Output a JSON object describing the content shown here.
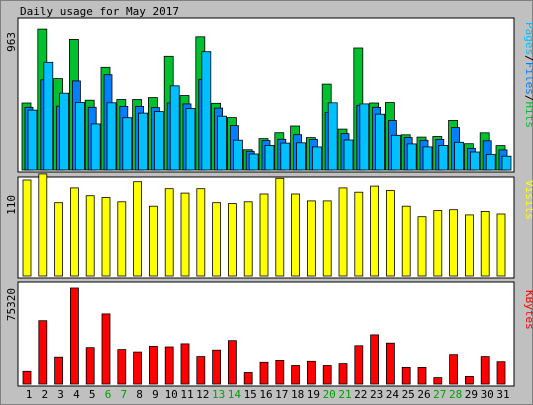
{
  "chart_data": [
    {
      "type": "bar",
      "title": "Daily usage for May 2017",
      "ylabel_parts": [
        "Pages",
        "/",
        "Files",
        "/",
        "Hits"
      ],
      "ymax_label": "963",
      "ylim": [
        0,
        963
      ],
      "categories": [
        "1",
        "2",
        "3",
        "4",
        "5",
        "6",
        "7",
        "8",
        "9",
        "10",
        "11",
        "12",
        "13",
        "14",
        "15",
        "16",
        "17",
        "18",
        "19",
        "20",
        "21",
        "22",
        "23",
        "24",
        "25",
        "26",
        "27",
        "28",
        "29",
        "30",
        "31"
      ],
      "weekend_days": [
        "6",
        "7",
        "13",
        "14",
        "20",
        "21",
        "27",
        "28"
      ],
      "series": [
        {
          "name": "Hits",
          "color": "#00c030",
          "values": [
            436,
            917,
            595,
            850,
            454,
            668,
            459,
            459,
            471,
            740,
            485,
            867,
            434,
            341,
            132,
            204,
            243,
            286,
            211,
            559,
            266,
            794,
            436,
            439,
            229,
            214,
            218,
            323,
            171,
            242,
            159
          ]
        },
        {
          "name": "Files",
          "color": "#0080ff",
          "values": [
            408,
            587,
            416,
            580,
            408,
            620,
            414,
            414,
            406,
            436,
            430,
            590,
            403,
            289,
            122,
            191,
            200,
            230,
            199,
            375,
            237,
            421,
            408,
            322,
            211,
            193,
            199,
            276,
            141,
            190,
            131
          ]
        },
        {
          "name": "Pages",
          "color": "#00c0ff",
          "values": [
            390,
            701,
            500,
            440,
            300,
            437,
            340,
            370,
            380,
            548,
            400,
            770,
            350,
            194,
            104,
            160,
            175,
            177,
            150,
            437,
            195,
            430,
            363,
            226,
            170,
            150,
            160,
            180,
            117,
            100,
            90
          ]
        }
      ]
    },
    {
      "type": "bar",
      "ylabel": "Visits",
      "ymax_label": "110",
      "ylim": [
        0,
        110
      ],
      "categories": [
        "1",
        "2",
        "3",
        "4",
        "5",
        "6",
        "7",
        "8",
        "9",
        "10",
        "11",
        "12",
        "13",
        "14",
        "15",
        "16",
        "17",
        "18",
        "19",
        "20",
        "21",
        "22",
        "23",
        "24",
        "25",
        "26",
        "27",
        "28",
        "29",
        "30",
        "31"
      ],
      "series": [
        {
          "name": "Visits",
          "color": "#ffff00",
          "values": [
            110,
            117,
            84,
            101,
            92,
            90,
            85,
            108,
            80,
            100,
            95,
            100,
            84,
            83,
            85,
            94,
            112,
            94,
            86,
            86,
            101,
            96,
            103,
            98,
            80,
            68,
            75,
            76,
            70,
            74,
            71
          ]
        }
      ]
    },
    {
      "type": "bar",
      "ylabel": "KBytes",
      "ymax_label": "75320",
      "ylim": [
        0,
        75320
      ],
      "categories": [
        "1",
        "2",
        "3",
        "4",
        "5",
        "6",
        "7",
        "8",
        "9",
        "10",
        "11",
        "12",
        "13",
        "14",
        "15",
        "16",
        "17",
        "18",
        "19",
        "20",
        "21",
        "22",
        "23",
        "24",
        "25",
        "26",
        "27",
        "28",
        "29",
        "30",
        "31"
      ],
      "series": [
        {
          "name": "KBytes",
          "color": "#ff0000",
          "values": [
            10000,
            49700,
            21000,
            75320,
            28500,
            55000,
            27000,
            25000,
            29500,
            29000,
            31500,
            21500,
            26500,
            34000,
            9000,
            17000,
            18500,
            14500,
            17800,
            14500,
            16000,
            30000,
            38500,
            32000,
            13000,
            13000,
            5000,
            23000,
            6000,
            21500,
            17500
          ]
        }
      ]
    }
  ],
  "colors": {
    "background": "#c0c0c0",
    "plot_background": "#ffffff",
    "border": "#000000",
    "weekday_label": "#000000",
    "weekend_label": "#00a000",
    "slash_color": "#000000"
  }
}
